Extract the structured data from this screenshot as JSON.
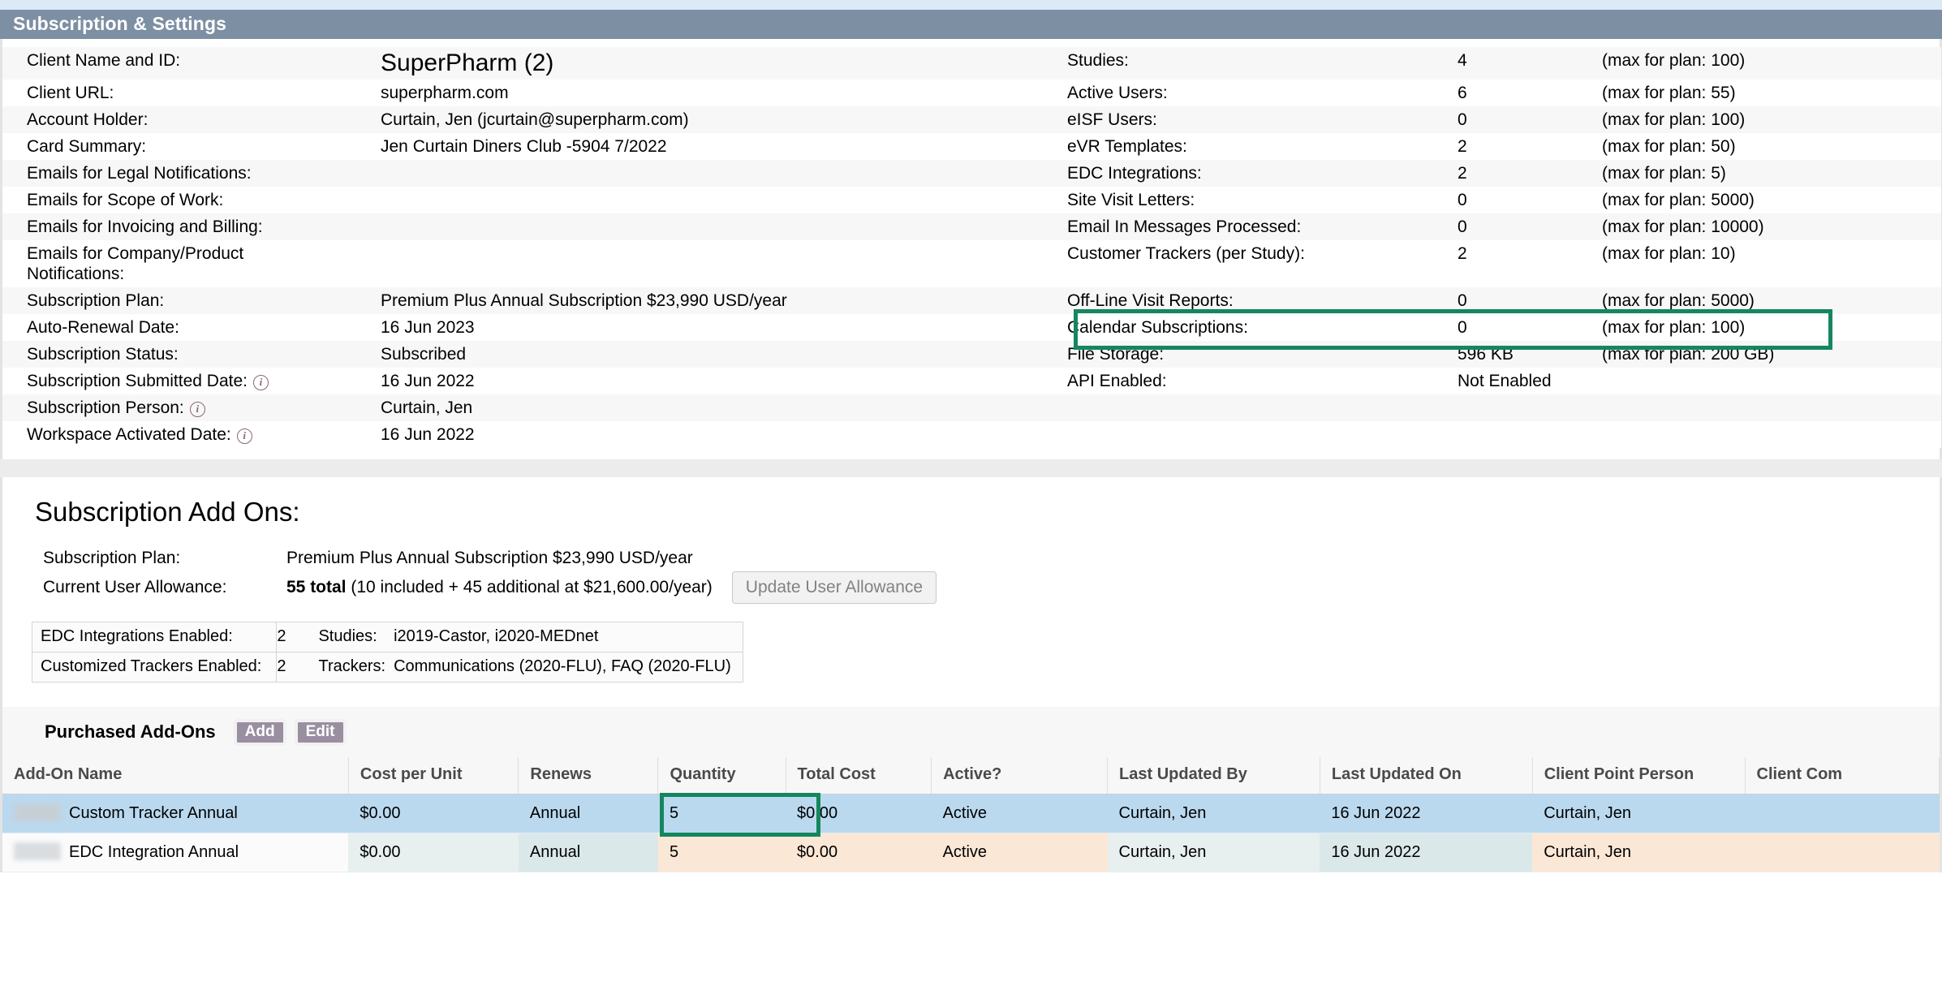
{
  "section": {
    "title": "Subscription & Settings"
  },
  "left_fields": [
    {
      "label": "Client Name and ID:",
      "value": "SuperPharm (2)",
      "big": true,
      "info": false
    },
    {
      "label": "Client URL:",
      "value": "superpharm.com",
      "big": false,
      "info": false
    },
    {
      "label": "Account Holder:",
      "value": "Curtain, Jen (jcurtain@superpharm.com)",
      "big": false,
      "info": false
    },
    {
      "label": "Card Summary:",
      "value": "Jen Curtain Diners Club -5904 7/2022",
      "big": false,
      "info": false
    },
    {
      "label": "Emails for Legal Notifications:",
      "value": "",
      "big": false,
      "info": false
    },
    {
      "label": "Emails for Scope of Work:",
      "value": "",
      "big": false,
      "info": false
    },
    {
      "label": "Emails for Invoicing and Billing:",
      "value": "",
      "big": false,
      "info": false
    },
    {
      "label": "Emails for Company/Product Notifications:",
      "value": "",
      "big": false,
      "info": false,
      "twoline": true
    },
    {
      "label": "Subscription Plan:",
      "value": "Premium Plus Annual Subscription $23,990 USD/year",
      "big": false,
      "info": false
    },
    {
      "label": "Auto-Renewal Date:",
      "value": "16 Jun 2023",
      "big": false,
      "info": false
    },
    {
      "label": "Subscription Status:",
      "value": "Subscribed",
      "big": false,
      "info": false
    },
    {
      "label": "Subscription Submitted Date:",
      "value": "16 Jun 2022",
      "big": false,
      "info": true
    },
    {
      "label": "Subscription Person:",
      "value": "Curtain, Jen",
      "big": false,
      "info": true
    },
    {
      "label": "Workspace Activated Date:",
      "value": "16 Jun 2022",
      "big": false,
      "info": true
    }
  ],
  "right_fields": [
    {
      "label": "Studies:",
      "value": "4",
      "max": "(max for plan: 100)"
    },
    {
      "label": "Active Users:",
      "value": "6",
      "max": "(max for plan: 55)"
    },
    {
      "label": "eISF Users:",
      "value": "0",
      "max": "(max for plan: 100)"
    },
    {
      "label": "eVR Templates:",
      "value": "2",
      "max": "(max for plan: 50)"
    },
    {
      "label": "EDC Integrations:",
      "value": "2",
      "max": "(max for plan: 5)"
    },
    {
      "label": "Site Visit Letters:",
      "value": "0",
      "max": "(max for plan: 5000)"
    },
    {
      "label": "Email In Messages Processed:",
      "value": "0",
      "max": "(max for plan: 10000)"
    },
    {
      "label": "Customer Trackers (per Study):",
      "value": "2",
      "max": "(max for plan: 10)",
      "highlighted": true
    },
    {
      "label": "Off-Line Visit Reports:",
      "value": "0",
      "max": "(max for plan: 5000)"
    },
    {
      "label": "Calendar Subscriptions:",
      "value": "0",
      "max": "(max for plan: 100)"
    },
    {
      "label": "File Storage:",
      "value": "596 KB",
      "max": "(max for plan: 200 GB)"
    },
    {
      "label": "API Enabled:",
      "value": "Not Enabled",
      "max": ""
    }
  ],
  "addons": {
    "title": "Subscription Add Ons:",
    "plan_label": "Subscription Plan:",
    "plan_value": "Premium Plus Annual Subscription $23,990 USD/year",
    "allowance_label": "Current User Allowance:",
    "allowance_bold": "55 total",
    "allowance_rest": "(10 included + 45 additional at $21,600.00/year)",
    "update_button": "Update User Allowance",
    "enabled_rows": [
      {
        "label": "EDC Integrations Enabled:",
        "count": "2",
        "sublabel": "Studies:",
        "value": "i2019-Castor, i2020-MEDnet"
      },
      {
        "label": "Customized Trackers Enabled:",
        "count": "2",
        "sublabel": "Trackers:",
        "value": "Communications (2020-FLU), FAQ (2020-FLU)"
      }
    ]
  },
  "purchased": {
    "title": "Purchased Add-Ons",
    "add_button": "Add",
    "edit_button": "Edit",
    "columns": [
      "Add-On Name",
      "Cost per Unit",
      "Renews",
      "Quantity",
      "Total Cost",
      "Active?",
      "Last Updated By",
      "Last Updated On",
      "Client Point Person",
      "Client Com"
    ],
    "rows": [
      {
        "name": "Custom Tracker Annual",
        "cost_per_unit": "$0.00",
        "renews": "Annual",
        "quantity": "5",
        "total_cost": "$0.00",
        "active": "Active",
        "last_updated_by": "Curtain, Jen",
        "last_updated_on": "16 Jun 2022",
        "client_point_person": "Curtain, Jen",
        "client_comment": "",
        "selected": true,
        "quantity_highlighted": true
      },
      {
        "name": "EDC Integration Annual",
        "cost_per_unit": "$0.00",
        "renews": "Annual",
        "quantity": "5",
        "total_cost": "$0.00",
        "active": "Active",
        "last_updated_by": "Curtain, Jen",
        "last_updated_on": "16 Jun 2022",
        "client_point_person": "Curtain, Jen",
        "client_comment": "",
        "selected": false,
        "quantity_highlighted": false
      }
    ]
  },
  "colors": {
    "header_bar": "#7d8fa3",
    "highlight_green": "#15865e",
    "selected_row": "#bad9ef",
    "info_icon": "#8d6474",
    "button_purple": "#9a8fa0"
  }
}
